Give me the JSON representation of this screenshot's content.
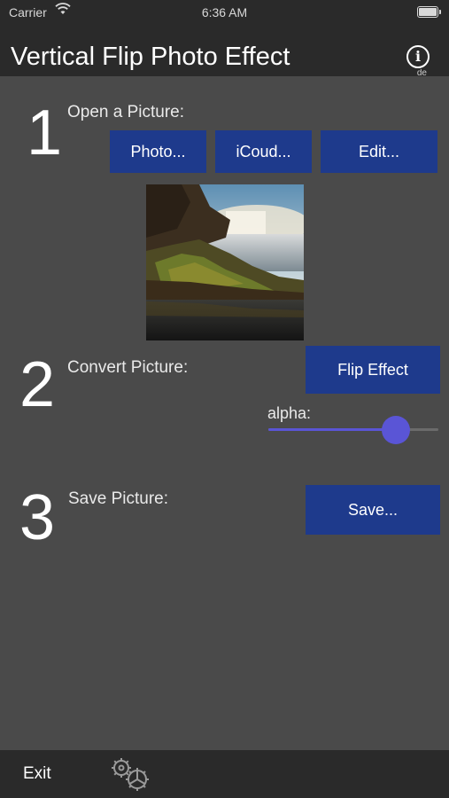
{
  "status_bar": {
    "carrier": "Carrier",
    "time": "6:36 AM",
    "wifi_icon": "wifi-icon",
    "battery_icon": "battery-icon"
  },
  "nav": {
    "title": "Vertical Flip Photo Effect",
    "info_icon": "info-icon",
    "info_label": "de"
  },
  "step1": {
    "number": "1",
    "label": "Open a Picture:",
    "buttons": [
      "Photo...",
      "iCoud...",
      "Edit..."
    ]
  },
  "preview": {
    "description_icon": "waterfall-photo"
  },
  "step2": {
    "number": "2",
    "label": "Convert Picture:",
    "button": "Flip Effect",
    "slider_label": "alpha:",
    "alpha_value": 0.75
  },
  "step3": {
    "number": "3",
    "label": "Save Picture:",
    "button": "Save..."
  },
  "bottom": {
    "exit_label": "Exit",
    "settings_icon": "gears-icon"
  },
  "colors": {
    "accent_button": "#1e3a8c",
    "slider": "#5a55d6",
    "background": "#4a4a4a",
    "bar": "#2a2a2a"
  }
}
